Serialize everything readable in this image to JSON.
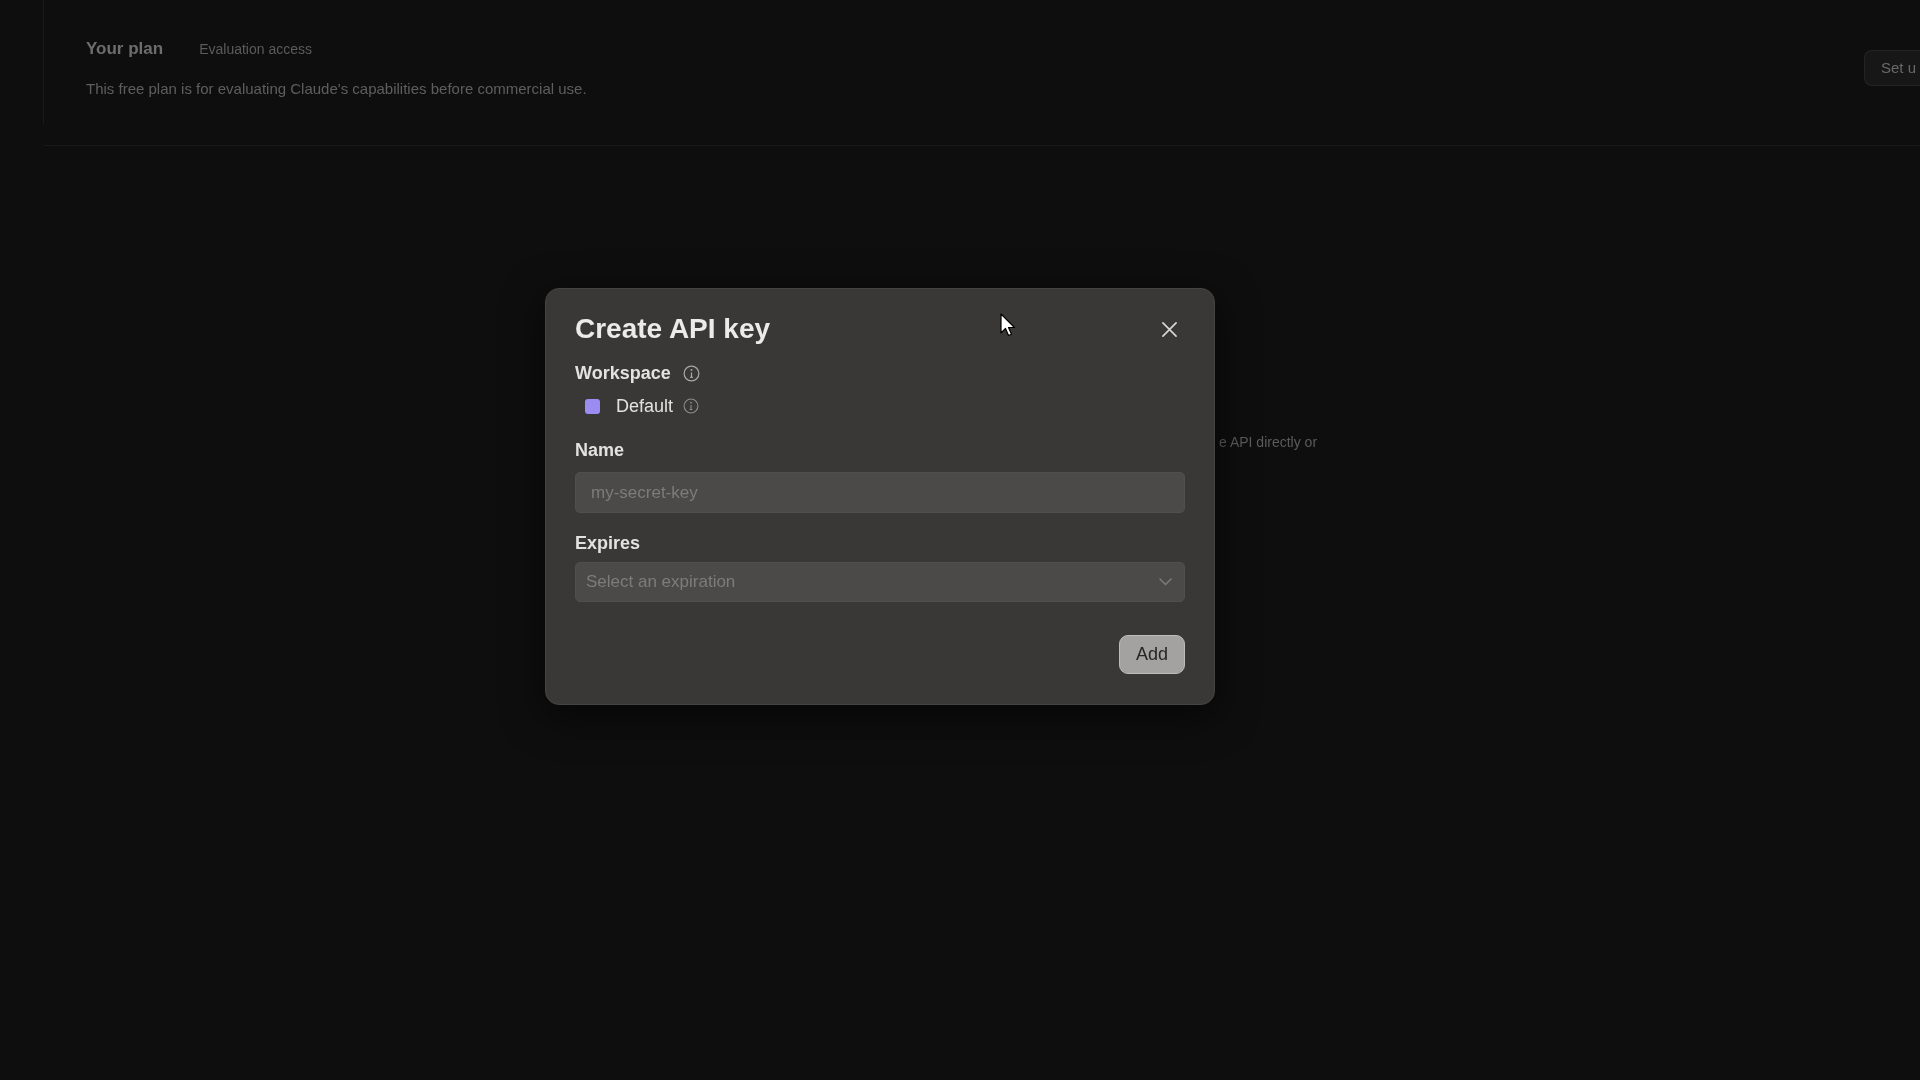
{
  "background": {
    "plan": {
      "title": "Your plan",
      "tier": "Evaluation access",
      "description": "This free plan is for evaluating Claude's capabilities before commercial use.",
      "button": "Set u"
    },
    "text_fragment": "e API directly or"
  },
  "dialog": {
    "title": "Create API key",
    "workspace": {
      "label": "Workspace",
      "items": [
        {
          "name": "Default",
          "color": "#9b8cf2"
        }
      ]
    },
    "fields": [
      {
        "kind": "text",
        "label": "Name",
        "placeholder": "my-secret-key"
      },
      {
        "kind": "select",
        "label": "Expires",
        "placeholder": "Select an expiration"
      }
    ],
    "submit": "Add"
  }
}
